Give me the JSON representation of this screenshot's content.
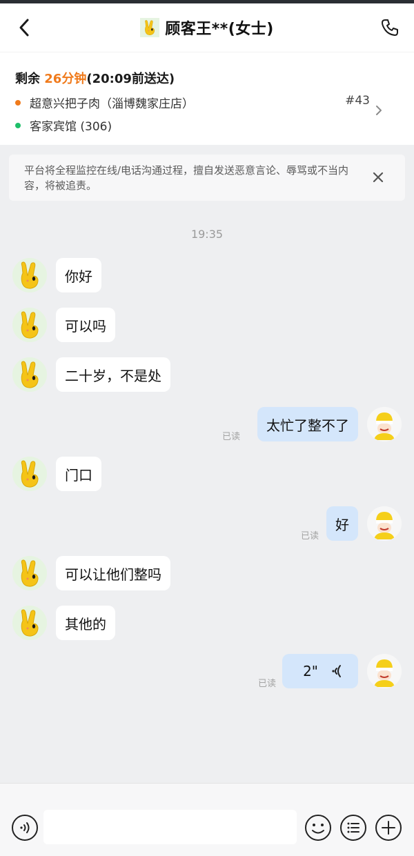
{
  "header": {
    "title": "顾客王**(女士)",
    "back_icon": "chevron-left-icon",
    "call_icon": "phone-icon"
  },
  "order": {
    "remaining_prefix": "剩余 ",
    "remaining_time": "26分钟",
    "deliver_by": "(20:09前送达)",
    "pickup": "超意兴把子肉（淄博魏家庄店）",
    "dropoff": "客家宾馆 (306)",
    "number": "#43",
    "pickup_color": "#f07a1b",
    "dropoff_color": "#1fbf6a"
  },
  "notice": {
    "text": "平台将全程监控在线/电话沟通过程，擅自发送恶意言论、辱骂或不当内容，将被追责。"
  },
  "chat": {
    "timestamp": "19:35",
    "messages": [
      {
        "from": "customer",
        "text": "你好"
      },
      {
        "from": "customer",
        "text": "可以吗"
      },
      {
        "from": "customer",
        "text": "二十岁，不是处"
      },
      {
        "from": "me",
        "text": "太忙了整不了",
        "status": "已读"
      },
      {
        "from": "customer",
        "text": "门口"
      },
      {
        "from": "me",
        "text": "好",
        "status": "已读"
      },
      {
        "from": "customer",
        "text": "可以让他们整吗"
      },
      {
        "from": "customer",
        "text": "其他的"
      },
      {
        "from": "me",
        "type": "voice",
        "text": "2\"",
        "status": "已读"
      }
    ]
  },
  "input": {
    "placeholder": "",
    "voice_icon": "voice-icon",
    "emoji_icon": "emoji-icon",
    "list_icon": "quick-reply-icon",
    "plus_icon": "plus-icon"
  },
  "colors": {
    "accent": "#f07a1b",
    "bubble_out": "#d4e6fb",
    "bubble_in": "#ffffff",
    "background": "#eeeff1"
  }
}
